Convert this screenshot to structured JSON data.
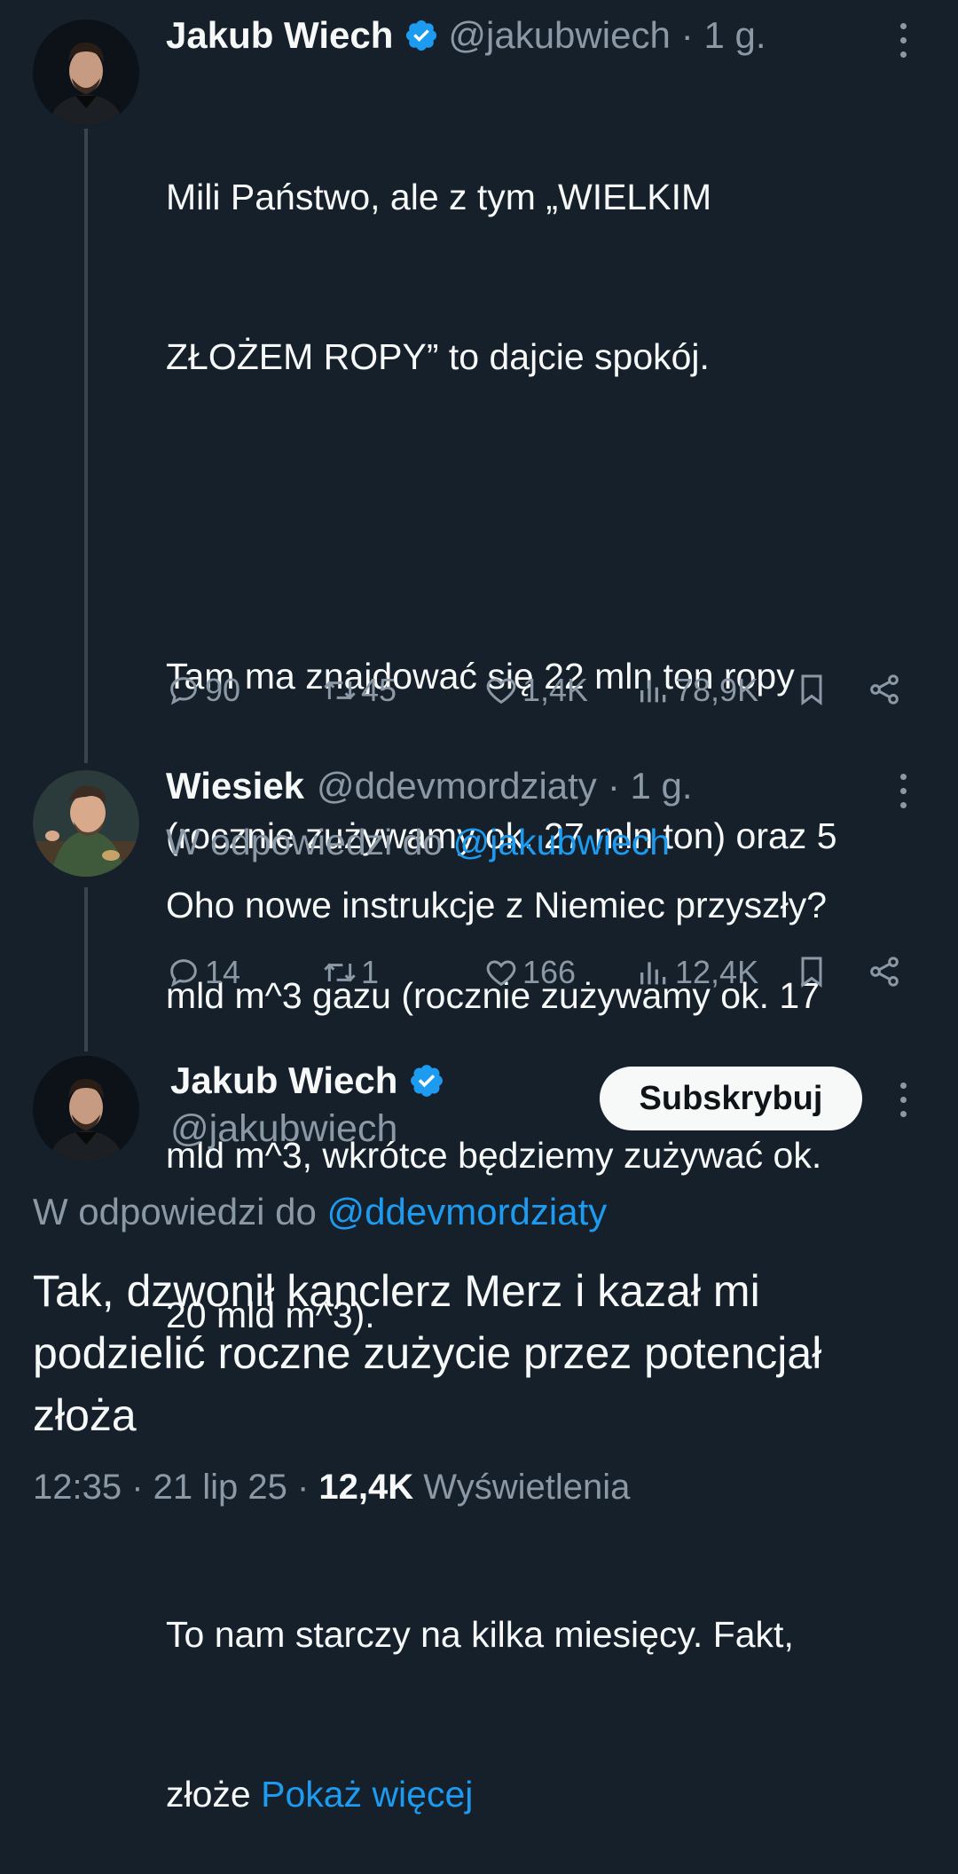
{
  "tweet1": {
    "name": "Jakub Wiech",
    "handle": "@jakubwiech",
    "time": "· 1 g.",
    "text_lines": [
      "Mili Państwo, ale z tym „WIELKIM",
      "ZŁOŻEM ROPY” to dajcie spokój.",
      "",
      "Tam ma znajdować się 22 mln ton ropy",
      "(rocznie zużywamy ok. 27 mln ton) oraz 5",
      "mld m^3 gazu (rocznie zużywamy ok. 17",
      "mld m^3, wkrótce będziemy zużywać ok.",
      "20 mld m^3).",
      "",
      "To nam starczy na kilka miesięcy. Fakt,"
    ],
    "last_line_start": "złoże ",
    "show_more": "Pokaż więcej",
    "stats": {
      "replies": "90",
      "retweets": "45",
      "likes": "1,4K",
      "views": "78,9K"
    }
  },
  "tweet2": {
    "name": "Wiesiek",
    "handle": "@ddevmordziaty",
    "time": "· 1 g.",
    "reply_prefix": "W odpowiedzi do ",
    "reply_handle": "@jakubwiech",
    "text": "Oho nowe instrukcje z Niemiec przyszły?",
    "stats": {
      "replies": "14",
      "retweets": "1",
      "likes": "166",
      "views": "12,4K"
    }
  },
  "tweet3": {
    "name": "Jakub Wiech",
    "handle": "@jakubwiech",
    "subscribe_label": "Subskrybuj",
    "reply_prefix": "W odpowiedzi do ",
    "reply_handle": "@ddevmordziaty",
    "text_lines": [
      "Tak, dzwonił kanclerz Merz i kazał mi",
      "podzielić roczne zużycie przez potencjał",
      "złoża"
    ],
    "timestamp": "12:35 · 21 lip 25 · ",
    "views_count": "12,4K",
    "views_label": " Wyświetlenia"
  },
  "colors": {
    "background": "#15202b",
    "accent": "#1d9bf0",
    "muted": "#8b98a5"
  },
  "icons": [
    "verified-badge-icon",
    "more-icon",
    "reply-icon",
    "retweet-icon",
    "like-icon",
    "views-icon",
    "bookmark-icon",
    "share-icon"
  ]
}
